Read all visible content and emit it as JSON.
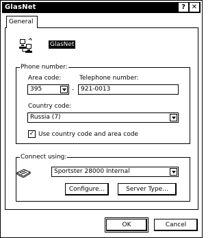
{
  "window": {
    "title": "GlasNet",
    "help_glyph": "?",
    "close_glyph": "✕"
  },
  "tabs": [
    {
      "label": "General"
    }
  ],
  "connection": {
    "name": "GlasNet"
  },
  "phone": {
    "group_label": "Phone number:",
    "area_code_label": "Area code:",
    "area_code_value": "395",
    "separator": "-",
    "telephone_label": "Telephone number:",
    "telephone_value": "921-0013",
    "country_label": "Country code:",
    "country_value": "Russia (7)",
    "use_country_label": "Use country code and area code",
    "use_country_checked": true
  },
  "connect": {
    "group_label": "Connect using:",
    "modem_value": "Sportster 28000 Internal",
    "configure_label": "Configure...",
    "server_type_label": "Server Type..."
  },
  "footer": {
    "ok_label": "OK",
    "cancel_label": "Cancel"
  }
}
